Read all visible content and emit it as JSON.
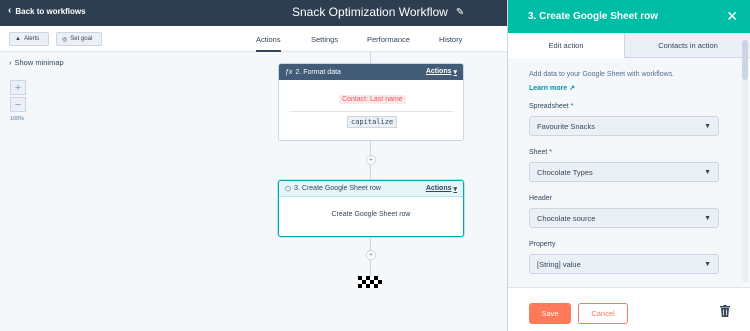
{
  "topbar": {
    "back_label": "Back to workflows",
    "title": "Snack Optimization Workflow"
  },
  "toolbar": {
    "alerts_label": "Alerts",
    "set_goal_label": "Set goal"
  },
  "tabs": [
    {
      "label": "Actions",
      "active": true
    },
    {
      "label": "Settings",
      "active": false
    },
    {
      "label": "Performance",
      "active": false
    },
    {
      "label": "History",
      "active": false
    }
  ],
  "canvas": {
    "minimap_label": "Show minimap",
    "zoom_plus": "+",
    "zoom_minus": "−",
    "zoom_level": "100%",
    "card1": {
      "icon": "fx-icon",
      "title": "2. Format data",
      "actions_label": "Actions",
      "token": "Contact: Last name",
      "operation": "capitalize"
    },
    "card2": {
      "icon": "google-sheets-icon",
      "title": "3. Create Google Sheet row",
      "actions_label": "Actions",
      "body": "Create Google Sheet row"
    },
    "plus": "+"
  },
  "panel": {
    "title": "3. Create Google Sheet row",
    "close": "✕",
    "tabs": [
      "Edit action",
      "Contacts in action"
    ],
    "description": "Add data to your Google Sheet with workflows.",
    "learn_more": "Learn more",
    "fields": [
      {
        "label": "Spreadsheet *",
        "value": "Favourite Snacks"
      },
      {
        "label": "Sheet *",
        "value": "Chocolate Types"
      },
      {
        "label": "Header",
        "value": "Chocolate source"
      },
      {
        "label": "Property",
        "value": "[String] value"
      }
    ],
    "save_label": "Save",
    "cancel_label": "Cancel"
  },
  "colors": {
    "topbar": "#2d3e50",
    "panel_header": "#00bda5",
    "primary_button": "#ff7a59",
    "link": "#0091ae"
  }
}
